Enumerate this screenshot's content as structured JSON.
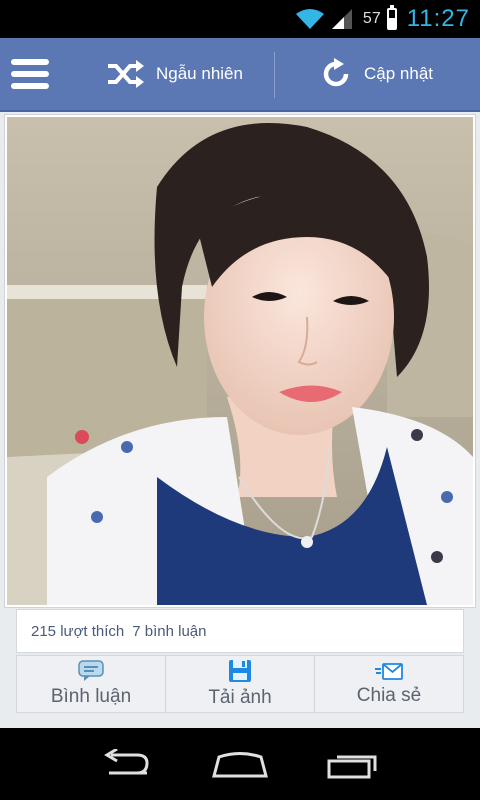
{
  "status_bar": {
    "battery_percent": "57",
    "battery_level": 0.57,
    "time": "11:27",
    "icons": [
      "wifi-icon",
      "cell-signal-icon",
      "battery-icon"
    ]
  },
  "action_bar": {
    "menu_icon": "hamburger-menu-icon",
    "random_label": "Ngẫu nhiên",
    "random_icon": "shuffle-icon",
    "refresh_label": "Cập nhật",
    "refresh_icon": "refresh-icon",
    "color": "#5b78b5"
  },
  "post": {
    "likes": "215 lượt thích",
    "comments": "7 bình luận"
  },
  "actions": [
    {
      "label": "Bình luận",
      "icon": "comment-icon"
    },
    {
      "label": "Tải ảnh",
      "icon": "save-icon"
    },
    {
      "label": "Chia sẻ",
      "icon": "share-icon"
    }
  ],
  "nav_bar": {
    "buttons": [
      "back-icon",
      "home-icon",
      "recent-apps-icon"
    ]
  }
}
